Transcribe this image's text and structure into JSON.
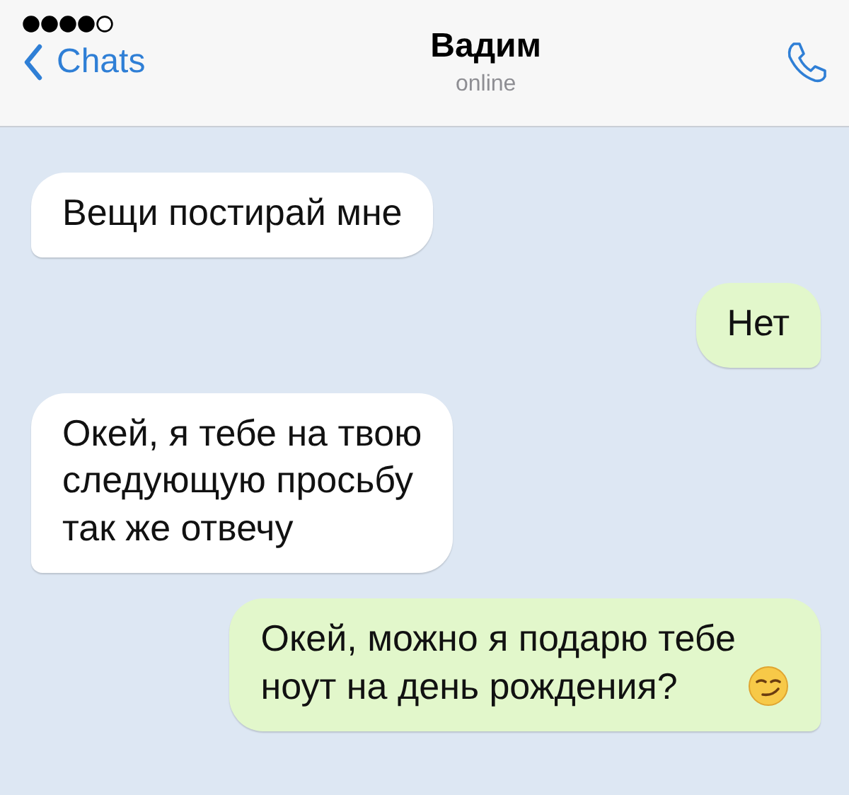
{
  "header": {
    "back_label": "Chats",
    "title": "Вадим",
    "status": "online"
  },
  "messages": [
    {
      "kind": "incoming",
      "text": "Вещи постирай мне",
      "has_emoji": false
    },
    {
      "kind": "outgoing",
      "text": "Нет",
      "has_emoji": false
    },
    {
      "kind": "incoming",
      "text": "Окей, я тебе на твою\nследующую просьбу\nтак же отвечу",
      "has_emoji": false
    },
    {
      "kind": "outgoing",
      "text": "Окей, можно я подарю тебе\nноут на день рождения?",
      "has_emoji": true
    }
  ]
}
